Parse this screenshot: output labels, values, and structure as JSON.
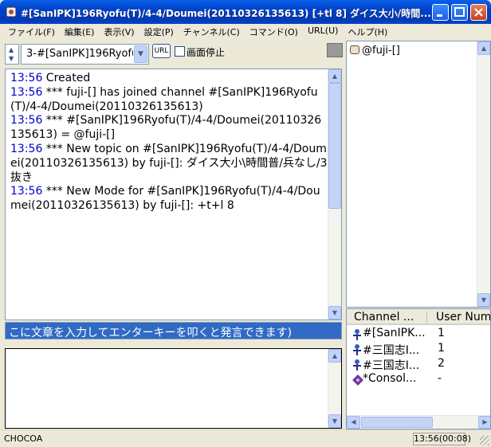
{
  "window": {
    "title": "#[SanIPK]196Ryofu(T)/4-4/Doumei(20110326135613) [+tl 8] ダイス大小/時間..."
  },
  "menu": [
    "ファイル(F)",
    "編集(E)",
    "表示(V)",
    "設定(P)",
    "チャンネル(C)",
    "コマンド(O)",
    "URL(U)",
    "ヘルプ(H)"
  ],
  "toolbar": {
    "channel_select": "3-#[SanIPK]196Ryofu",
    "url_button": "URL",
    "pause_label": "画面停止"
  },
  "log": [
    {
      "time": "13:56",
      "text": " Created"
    },
    {
      "time": "13:56",
      "text": " *** fuji-[] has joined channel #[SanIPK]196Ryofu(T)/4-4/Doumei(20110326135613)"
    },
    {
      "time": "13:56",
      "text": " *** #[SanIPK]196Ryofu(T)/4-4/Doumei(20110326135613) = @fuji-[]"
    },
    {
      "time": "13:56",
      "text": " *** New topic on #[SanIPK]196Ryofu(T)/4-4/Doumei(20110326135613) by fuji-[]: ダイス大小\\時間普/兵なし/3抜き"
    },
    {
      "time": "13:56",
      "text": " *** New Mode for #[SanIPK]196Ryofu(T)/4-4/Doumei(20110326135613) by fuji-[]: +t+l 8"
    }
  ],
  "input_hint": "こに文章を入力してエンターキーを叩くと発言できます)",
  "nicklist": [
    "@fuji-[]"
  ],
  "channels": {
    "headers": [
      "Channel ...",
      "User Num"
    ],
    "rows": [
      {
        "name": "#[SanIPK...",
        "users": "1"
      },
      {
        "name": "#三国志I...",
        "users": "1"
      },
      {
        "name": "#三国志I...",
        "users": "2"
      },
      {
        "name": "*Consol...",
        "users": "-"
      }
    ]
  },
  "status": {
    "left": "CHOCOA",
    "right": "13:56(00:08)"
  },
  "colors": {
    "timestamp": "#0000c8",
    "input_bg": "#316ac5",
    "titlebar": "#0042c8"
  }
}
